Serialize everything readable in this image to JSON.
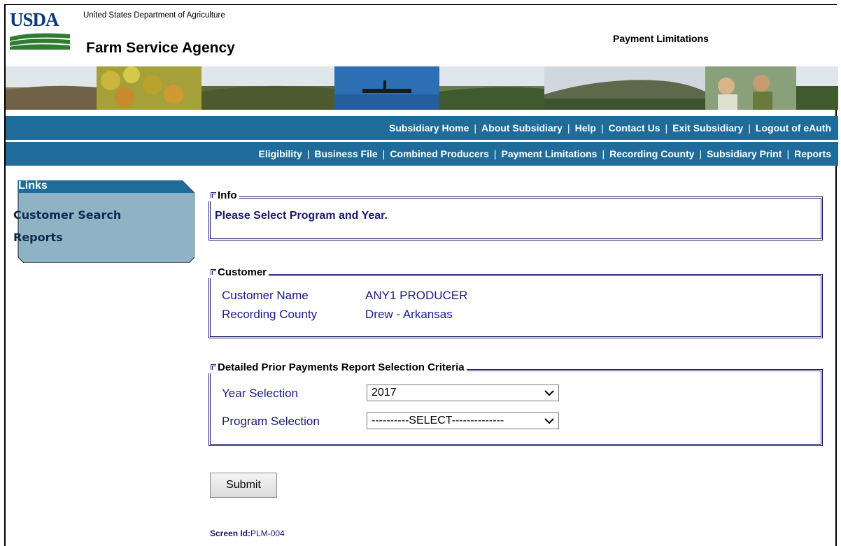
{
  "header": {
    "logo_text": "USDA",
    "department": "United States Department of Agriculture",
    "agency": "Farm Service Agency",
    "app_title": "Payment Limitations"
  },
  "nav_primary": [
    {
      "label": "Subsidiary Home"
    },
    {
      "label": "About Subsidiary"
    },
    {
      "label": "Help"
    },
    {
      "label": "Contact Us"
    },
    {
      "label": "Exit Subsidiary"
    },
    {
      "label": "Logout of eAuth"
    }
  ],
  "nav_secondary": [
    {
      "label": "Eligibility"
    },
    {
      "label": "Business File"
    },
    {
      "label": "Combined Producers"
    },
    {
      "label": "Payment Limitations"
    },
    {
      "label": "Recording County"
    },
    {
      "label": "Subsidiary Print"
    },
    {
      "label": "Reports"
    }
  ],
  "sidebar": {
    "title": "Links",
    "items": [
      {
        "label": "Customer Search"
      },
      {
        "label": "Reports"
      }
    ]
  },
  "info": {
    "legend": "Info",
    "message": "Please Select Program and Year."
  },
  "customer": {
    "legend": "Customer",
    "name_label": "Customer Name",
    "name_value": "ANY1 PRODUCER",
    "county_label": "Recording County",
    "county_value": "Drew - Arkansas"
  },
  "criteria": {
    "legend": "Detailed Prior Payments Report Selection Criteria",
    "year_label": "Year Selection",
    "year_value": "2017",
    "program_label": "Program Selection",
    "program_value": "----------SELECT--------------"
  },
  "submit_label": "Submit",
  "footer": {
    "screen_id_label": "Screen Id:",
    "screen_id_value": "PLM-004"
  },
  "colors": {
    "nav_bg": "#1f6b99",
    "sidebar_bg": "#8fb3c4",
    "sidebar_header": "#1f6b99",
    "fieldset_border": "#1a1a6e",
    "text_blue": "#1a1a8a"
  }
}
